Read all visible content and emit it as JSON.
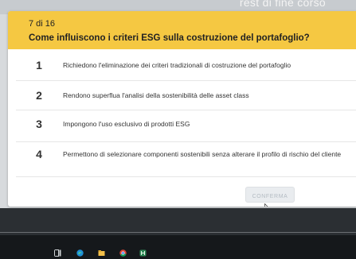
{
  "header_strip": {
    "text": "rest di fine corso"
  },
  "question": {
    "counter": "7 di 16",
    "title": "Come influiscono i criteri ESG sulla costruzione del portafoglio?"
  },
  "answers": [
    {
      "number": "1",
      "text": "Richiedono l'eliminazione dei criteri tradizionali di costruzione del portafoglio"
    },
    {
      "number": "2",
      "text": "Rendono superflua l'analisi della sostenibilità delle asset class"
    },
    {
      "number": "3",
      "text": "Impongono l'uso esclusivo di prodotti ESG"
    },
    {
      "number": "4",
      "text": "Permettono di selezionare componenti sostenibili senza alterare il profilo di rischio del cliente"
    }
  ],
  "confirm_label": "CONFERMA",
  "colors": {
    "accent": "#f5c842",
    "background": "#d7dadd",
    "card": "#ffffff",
    "taskbar": "#15181b"
  },
  "taskbar_icons": [
    "taskview-icon",
    "edge-browser-icon",
    "file-explorer-icon",
    "chrome-icon",
    "app-icon"
  ]
}
